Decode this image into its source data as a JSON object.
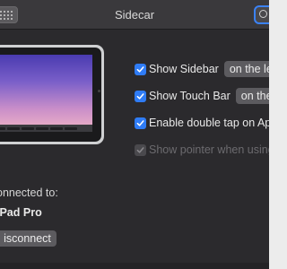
{
  "window": {
    "title": "Sidecar"
  },
  "options": [
    {
      "label": "Show Sidebar",
      "value": "on the left",
      "checked": true,
      "enabled": true
    },
    {
      "label": "Show Touch Bar",
      "value": "on the b",
      "checked": true,
      "enabled": true
    },
    {
      "label": "Enable double tap on Apple",
      "checked": true,
      "enabled": true
    },
    {
      "label": "Show pointer when using A",
      "checked": true,
      "enabled": false
    }
  ],
  "connection": {
    "connected_label": "onnected to:",
    "device_name": "iPad Pro",
    "disconnect_label": "isconnect"
  },
  "icons": {
    "grid": "grid-icon",
    "search": "search-icon",
    "check": "checkmark-icon"
  },
  "colors": {
    "accent": "#2f7cf6",
    "background": "#2b2a2d"
  }
}
